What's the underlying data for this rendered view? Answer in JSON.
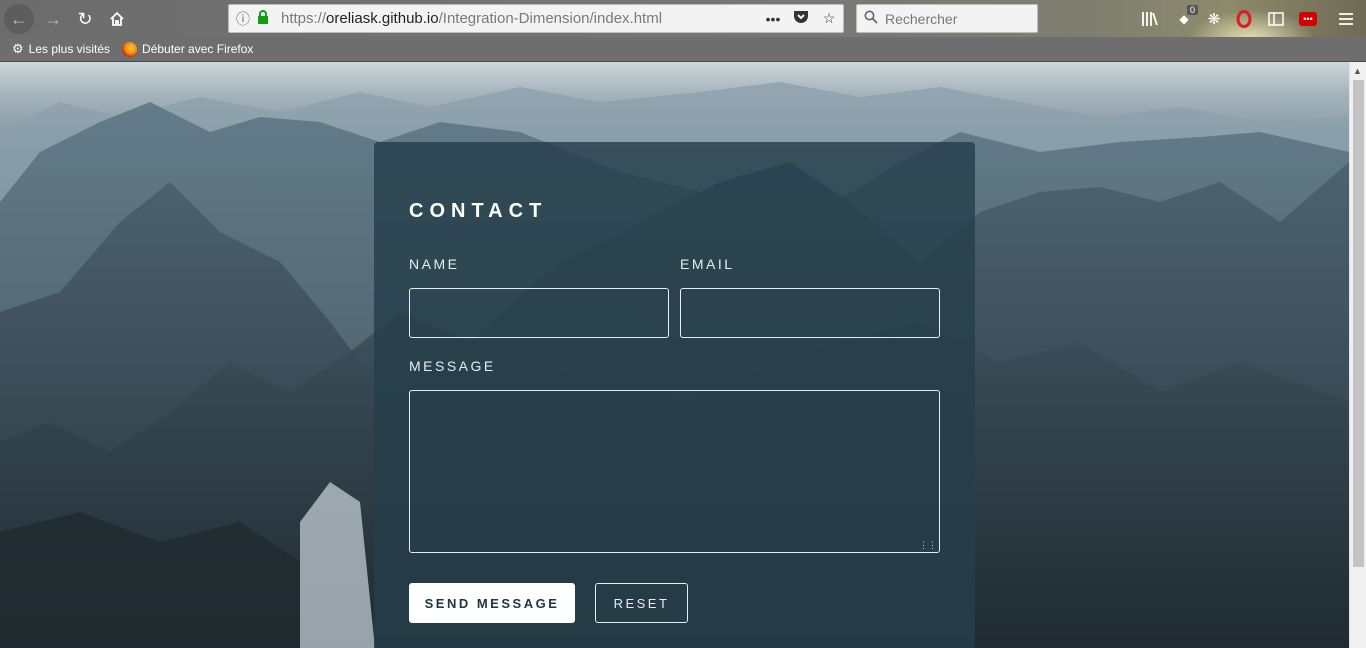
{
  "browser": {
    "url_prefix": "https://",
    "url_domain": "oreliask.github.io",
    "url_path": "/Integration-Dimension/index.html",
    "search_placeholder": "Rechercher",
    "extension_badge": "0",
    "bookmarks": [
      {
        "label": "Les plus visités",
        "icon": "gear-icon"
      },
      {
        "label": "Débuter avec Firefox",
        "icon": "firefox-icon"
      }
    ]
  },
  "contact": {
    "title": "CONTACT",
    "name_label": "NAME",
    "email_label": "EMAIL",
    "message_label": "MESSAGE",
    "send_label": "SEND MESSAGE",
    "reset_label": "RESET"
  }
}
